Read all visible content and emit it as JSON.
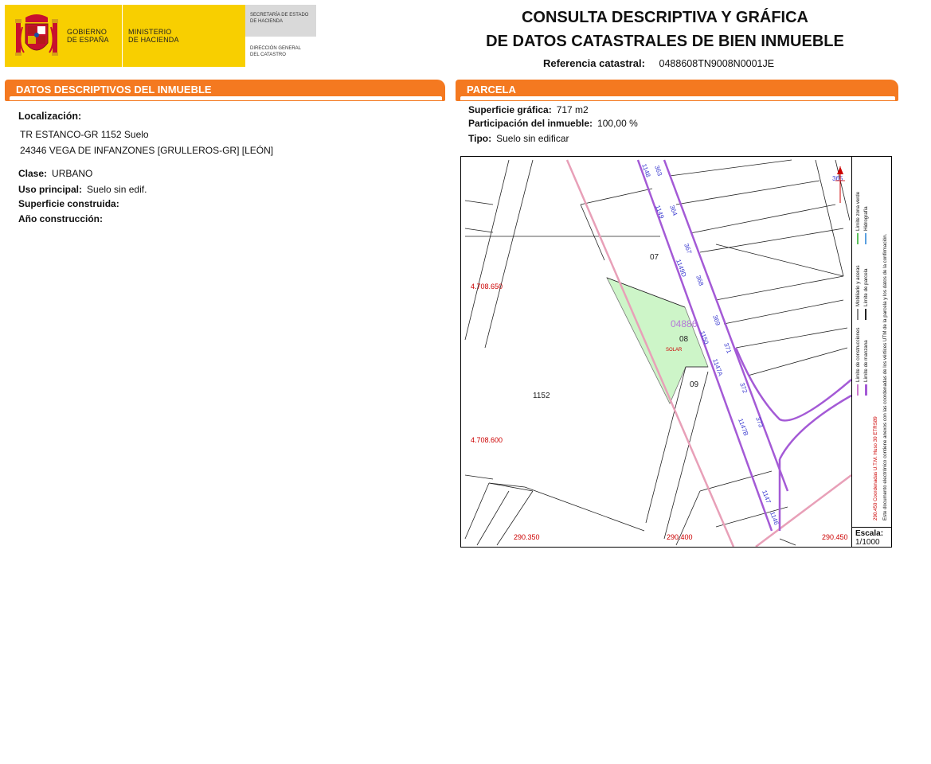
{
  "header": {
    "gobierno": [
      "GOBIERNO",
      "DE ESPAÑA"
    ],
    "ministerio": [
      "MINISTERIO",
      "DE HACIENDA"
    ],
    "secretaria": [
      "SECRETARÍA DE ESTADO",
      "DE HACIENDA"
    ],
    "direccion": [
      "DIRECCIÓN GENERAL",
      "DEL CATASTRO"
    ],
    "title_line1": "CONSULTA DESCRIPTIVA Y GRÁFICA",
    "title_line2": "DE DATOS CATASTRALES DE BIEN INMUEBLE",
    "ref_label": "Referencia catastral:",
    "ref_value": "0488608TN9008N0001JE"
  },
  "colors": {
    "orange": "#f47920",
    "parcel_fill": "#cdf5c8",
    "road": "#a45ad6",
    "boundary": "#e8a0b8",
    "coord": "#cc0000"
  },
  "left": {
    "section_title": "DATOS DESCRIPTIVOS DEL INMUEBLE",
    "localizacion_label": "Localización:",
    "address1": "TR ESTANCO-GR 1152 Suelo",
    "address2": "24346 VEGA DE INFANZONES [GRULLEROS-GR] [LEÓN]",
    "clase_label": "Clase:",
    "clase_value": "URBANO",
    "uso_label": "Uso principal:",
    "uso_value": "Suelo sin edif.",
    "superficie_label": "Superficie construida:",
    "anio_label": "Año construcción:"
  },
  "right": {
    "section_title": "PARCELA",
    "sup_label": "Superficie gráfica:",
    "sup_value": "717 m2",
    "part_label": "Participación del inmueble:",
    "part_value": "100,00 %",
    "tipo_label": "Tipo:",
    "tipo_value": "Suelo sin edificar"
  },
  "map": {
    "coords": {
      "y1": "4.708.650",
      "y2": "4.708.600",
      "x1": "290.350",
      "x2": "290.400",
      "x3": "290.450"
    },
    "block": "04886",
    "parcels": {
      "p07": "07",
      "p08": "08",
      "p09": "09",
      "p1152": "1152"
    },
    "solar": "SOLAR",
    "road_numbers": [
      "363",
      "364",
      "367",
      "368",
      "369",
      "371",
      "372",
      "373",
      "365"
    ],
    "road_codes": [
      "1148",
      "1149",
      "1149D",
      "1150",
      "1147A",
      "1147B",
      "1147",
      "1146"
    ],
    "scale_label": "Escala:",
    "scale_value": "1/1000",
    "legend": {
      "line1": "Este documento electrónico contiene anexos con las coordenadas de los vértices UTM de la parcela y los datos de la confirmación.",
      "line2": "290.450 Coordenadas U.T.M. Huso 30 ETRS89",
      "limite_manzana": "Límite de manzana",
      "limite_parcela": "Límite de parcela",
      "hidrografia": "Hidrografía",
      "limite_construcciones": "Límite de construcciones",
      "mobiliario": "Mobiliario y aceras",
      "limite_zona_verde": "Límite zona verde"
    }
  }
}
